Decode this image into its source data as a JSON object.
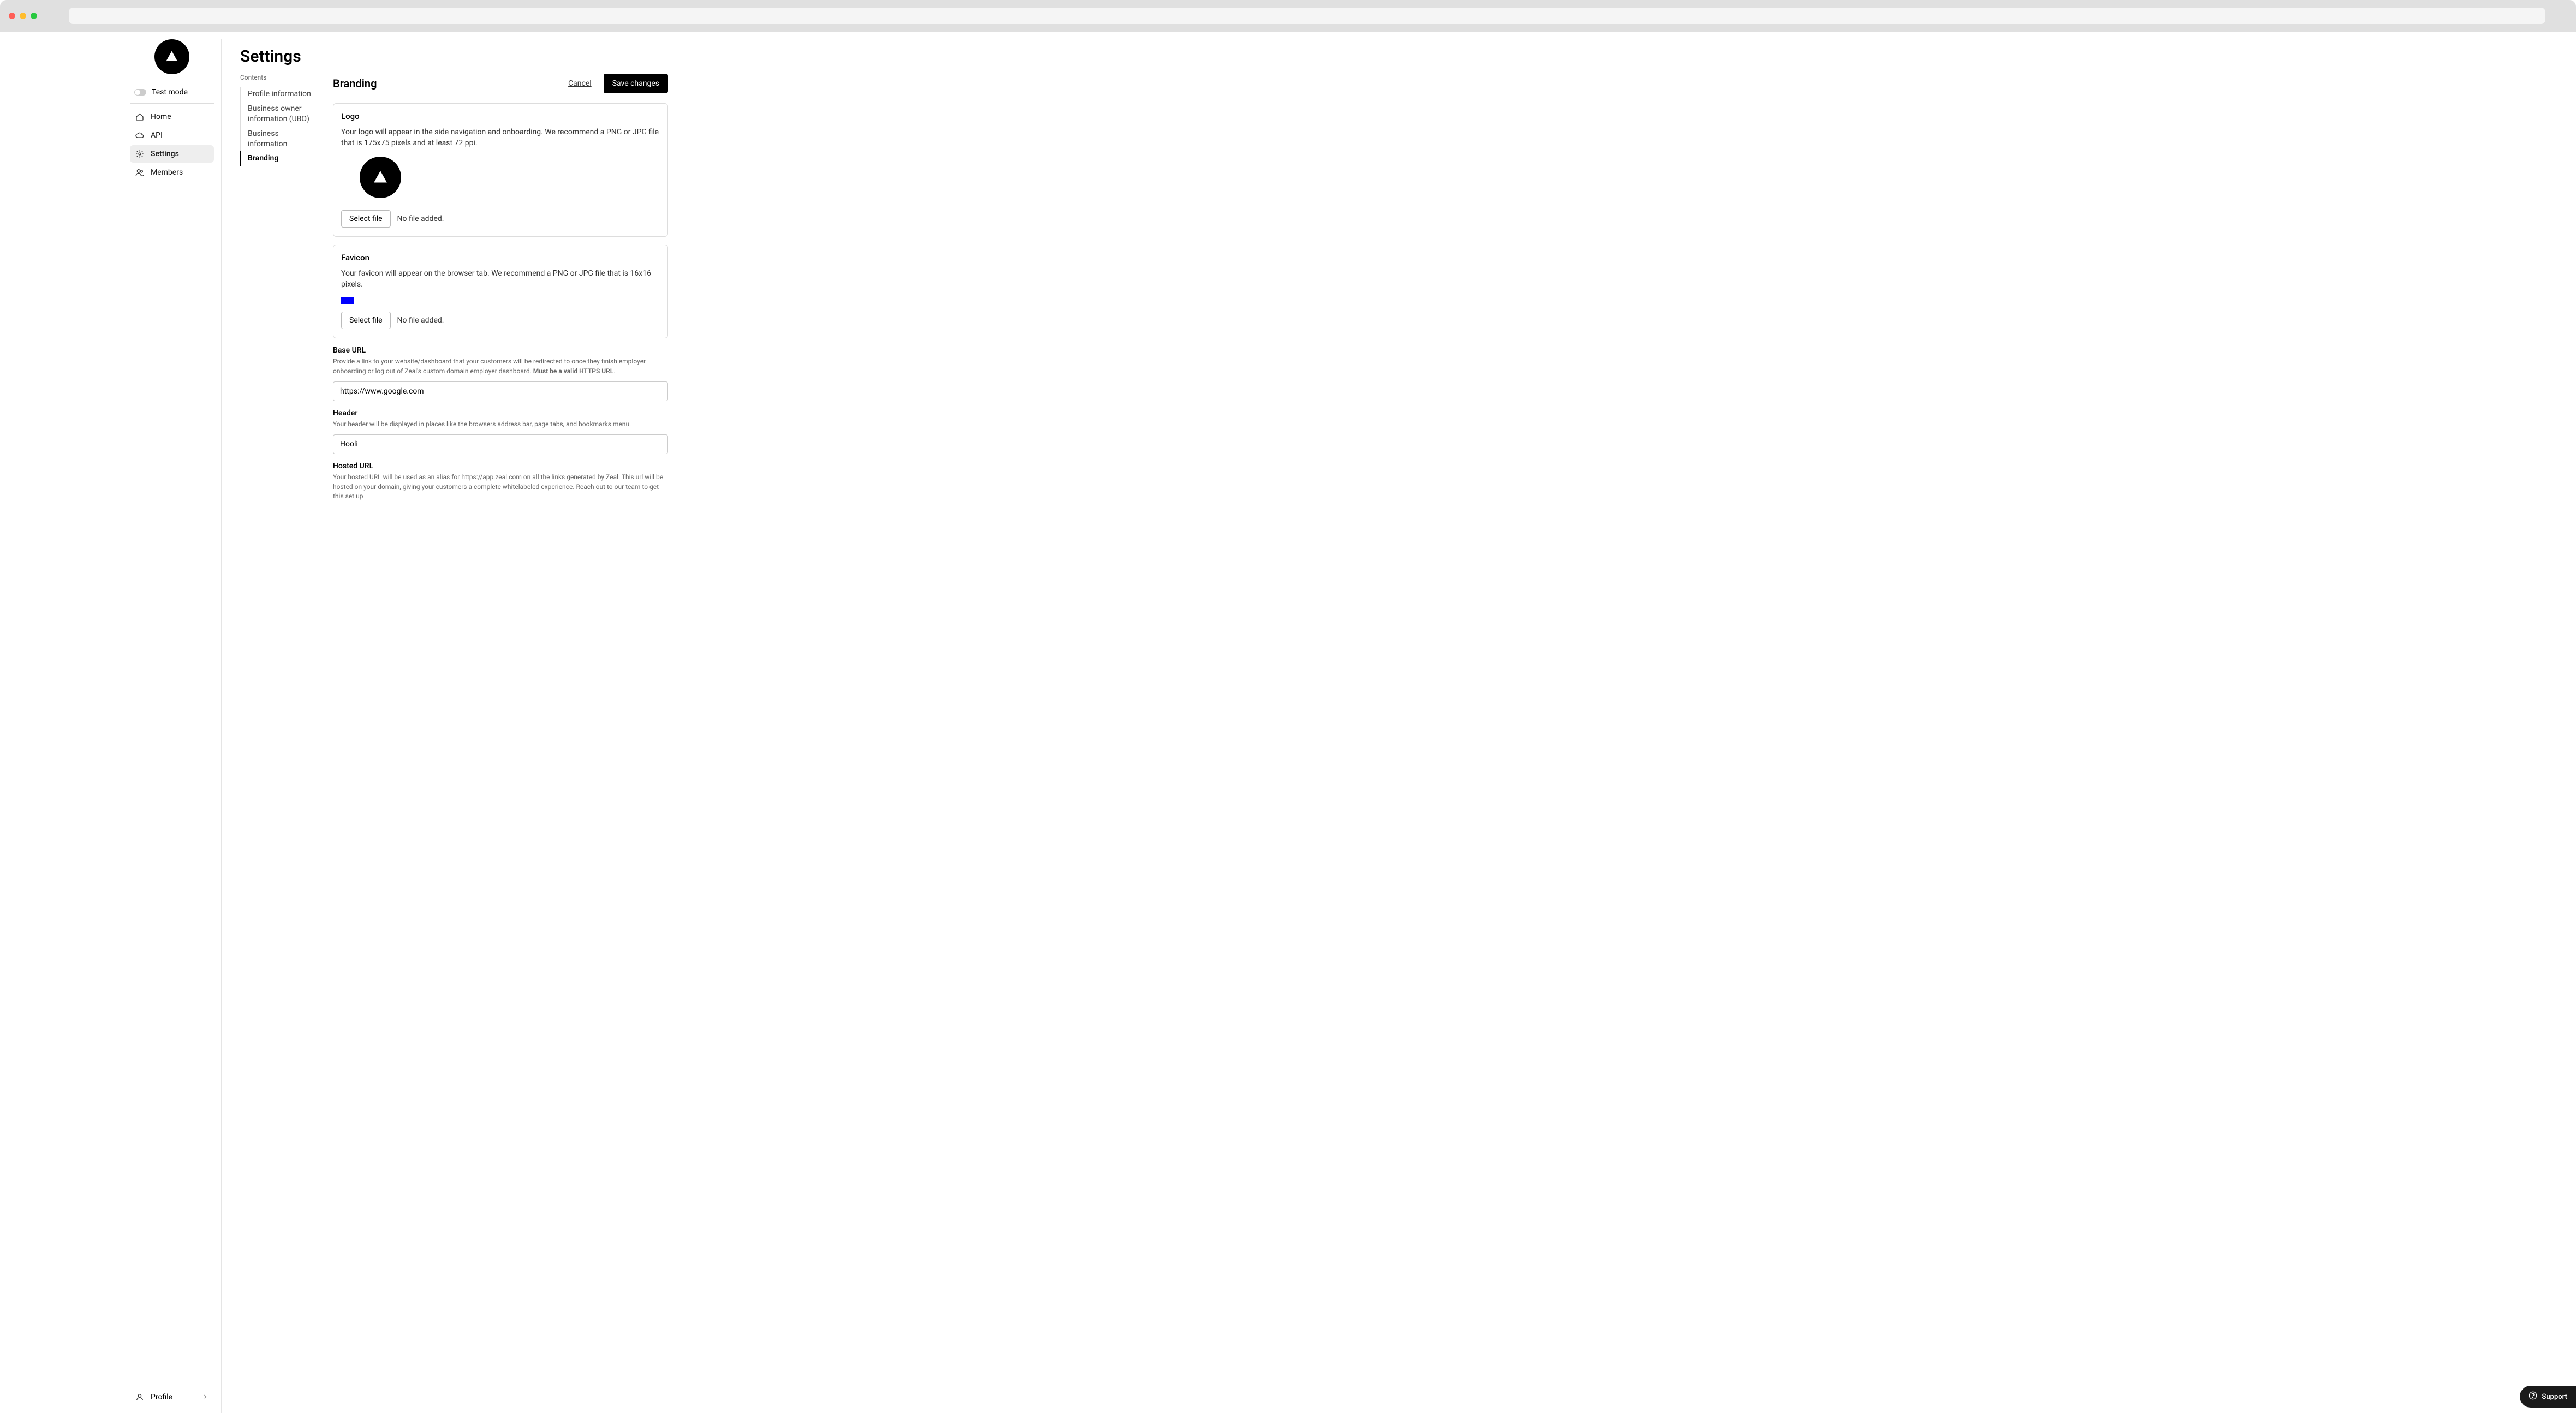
{
  "sidebar": {
    "test_mode_label": "Test mode",
    "items": [
      {
        "label": "Home",
        "icon": "home-icon"
      },
      {
        "label": "API",
        "icon": "cloud-icon"
      },
      {
        "label": "Settings",
        "icon": "gear-icon"
      },
      {
        "label": "Members",
        "icon": "members-icon"
      }
    ],
    "profile_label": "Profile"
  },
  "page": {
    "title": "Settings",
    "contents_label": "Contents"
  },
  "toc": [
    {
      "label": "Profile information"
    },
    {
      "label": "Business owner information (UBO)"
    },
    {
      "label": "Business information"
    },
    {
      "label": "Branding"
    }
  ],
  "section": {
    "title": "Branding",
    "cancel_label": "Cancel",
    "save_label": "Save changes"
  },
  "logo_card": {
    "title": "Logo",
    "desc": "Your logo will appear in the side navigation and onboarding. We recommend a PNG or JPG file that is 175x75 pixels and at least 72 ppi.",
    "select_label": "Select file",
    "status": "No file added."
  },
  "favicon_card": {
    "title": "Favicon",
    "desc": "Your favicon will appear on the browser tab. We recommend a PNG or JPG file that is 16x16 pixels.",
    "select_label": "Select file",
    "status": "No file added."
  },
  "base_url": {
    "label": "Base URL",
    "desc_pre": "Provide a link to your website/dashboard that your customers will be redirected to once they finish employer onboarding or log out of Zeal's custom domain employer dashboard. ",
    "desc_strong": "Must be a valid HTTPS URL",
    "value": "https://www.google.com"
  },
  "header_field": {
    "label": "Header",
    "desc": "Your header will be displayed in places like the browsers address bar, page tabs, and bookmarks menu.",
    "value": "Hooli"
  },
  "hosted_url": {
    "label": "Hosted URL",
    "desc": "Your hosted URL will be used as an alias for https://app.zeal.com on all the links generated by Zeal. This url will be hosted on your domain, giving your customers a complete whitelabeled experience. Reach out to our team to get this set up"
  },
  "support": {
    "label": "Support"
  }
}
